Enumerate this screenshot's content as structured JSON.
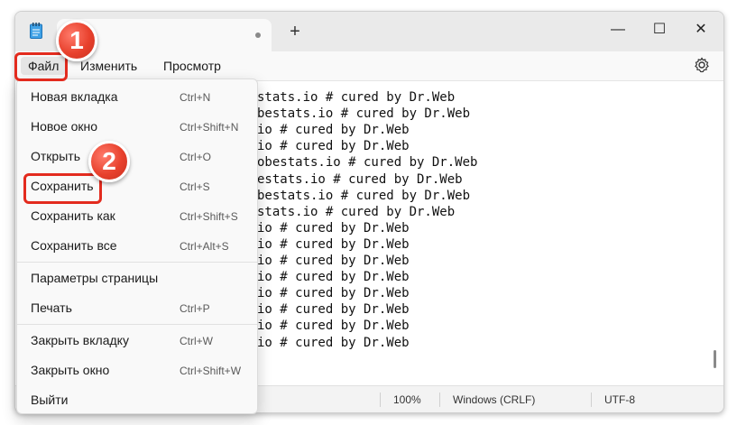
{
  "window": {
    "min_symbol": "—",
    "max_symbol": "☐",
    "close_symbol": "✕",
    "new_tab_symbol": "+"
  },
  "menubar": {
    "file": "Файл",
    "edit": "Изменить",
    "view": "Просмотр"
  },
  "editor_lines": [
    "stats.io # cured by Dr.Web",
    "bestats.io # cured by Dr.Web",
    "io # cured by Dr.Web",
    "io # cured by Dr.Web",
    "obestats.io # cured by Dr.Web",
    "estats.io # cured by Dr.Web",
    "bestats.io # cured by Dr.Web",
    "stats.io # cured by Dr.Web",
    "io # cured by Dr.Web",
    "io # cured by Dr.Web",
    "io # cured by Dr.Web",
    "io # cured by Dr.Web",
    "io # cured by Dr.Web",
    "io # cured by Dr.Web",
    "io # cured by Dr.Web",
    "io # cured by Dr.Web"
  ],
  "file_menu": {
    "items": [
      {
        "label": "Новая вкладка",
        "shortcut": "Ctrl+N"
      },
      {
        "label": "Новое окно",
        "shortcut": "Ctrl+Shift+N"
      },
      {
        "label": "Открыть",
        "shortcut": "Ctrl+O"
      },
      {
        "label": "Сохранить",
        "shortcut": "Ctrl+S"
      },
      {
        "label": "Сохранить как",
        "shortcut": "Ctrl+Shift+S"
      },
      {
        "label": "Сохранить все",
        "shortcut": "Ctrl+Alt+S"
      },
      {
        "label": "Параметры страницы",
        "shortcut": ""
      },
      {
        "label": "Печать",
        "shortcut": "Ctrl+P"
      },
      {
        "label": "Закрыть вкладку",
        "shortcut": "Ctrl+W"
      },
      {
        "label": "Закрыть окно",
        "shortcut": "Ctrl+Shift+W"
      },
      {
        "label": "Выйти",
        "shortcut": ""
      }
    ]
  },
  "statusbar": {
    "zoom": "100%",
    "line_ending": "Windows (CRLF)",
    "encoding": "UTF-8"
  },
  "callouts": {
    "step1": "1",
    "step2": "2"
  },
  "colors": {
    "accent": "#e32b1e",
    "menu_bg": "#f9f9f9"
  }
}
